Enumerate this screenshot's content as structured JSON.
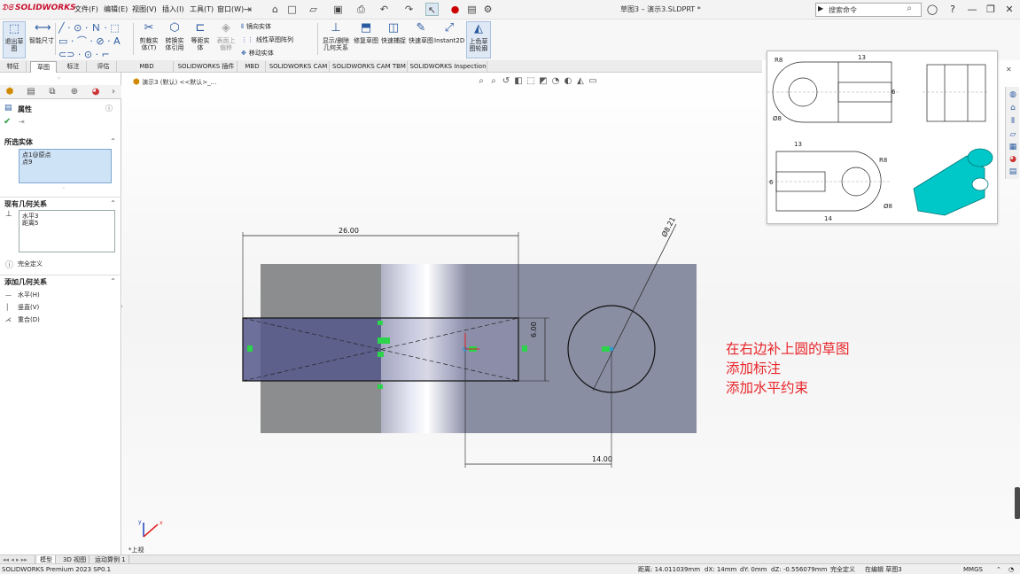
{
  "app": {
    "brand": "SOLIDWORKS"
  },
  "menu": [
    "文件(F)",
    "编辑(E)",
    "视图(V)",
    "插入(I)",
    "工具(T)",
    "窗口(W)"
  ],
  "title": "草图3 – 演示3.SLDPRT *",
  "search": {
    "placeholder": "搜索命令"
  },
  "ribbon": {
    "exit_sketch": "退出草图",
    "smart_dimension": "智能尺寸",
    "trim": "剪裁实体(T)",
    "convert": "转换实体引用",
    "offset": "等距实体",
    "surface_offset": "表面上偏移",
    "mirror": "镜向实体",
    "linear_pattern": "线性草图阵列",
    "move": "移动实体",
    "display_relations": "显示/删除几何关系",
    "repair": "修复草图",
    "quick_snaps": "快速捕捉",
    "rapid_sketch": "快速草图",
    "instant2d": "Instant2D",
    "shaded_contours": "上色草图轮廓"
  },
  "tabs": [
    "特征",
    "草图",
    "标注",
    "评估",
    "MBD Dimensions",
    "SOLIDWORKS 插件",
    "MBD",
    "SOLIDWORKS CAM",
    "SOLIDWORKS CAM TBM",
    "SOLIDWORKS Inspection"
  ],
  "breadcrumb": "演示3 (默认) <<默认>_...",
  "panel": {
    "title": "属性",
    "selected_entities_title": "所选实体",
    "selected_entities": [
      "点1@原点",
      "点9"
    ],
    "existing_relations_title": "现有几何关系",
    "existing_relations": [
      "水平3",
      "距离5"
    ],
    "status": "完全定义",
    "add_relations_title": "添加几何关系",
    "add_relations": [
      "水平(H)",
      "竖直(V)",
      "重合(D)"
    ]
  },
  "dimensions": {
    "width": "26.00",
    "height": "6.00",
    "diameter": "Ø8.21",
    "offset": "14.00"
  },
  "drawing_view": {
    "r_top": "R8",
    "top_13": "13",
    "top_6": "6",
    "top_d": "Ø8",
    "bottom_13": "13",
    "bottom_r": "R8",
    "bottom_14": "14",
    "bottom_6": "6",
    "bottom_d": "Ø8"
  },
  "annotation": [
    "在右边补上圆的草图",
    "添加标注",
    "添加水平约束"
  ],
  "view_label": "*上视",
  "triad": {
    "x": "x",
    "y": "y"
  },
  "bottom_tabs": [
    "模型",
    "3D 视图",
    "运动算例 1"
  ],
  "status": {
    "product": "SOLIDWORKS Premium 2023 SP0.1",
    "distance": "距离: 14.011039mm",
    "dx": "dX: 14mm",
    "dy": "dY: 0mm",
    "dz": "dZ: -0.556079mm",
    "defined": "完全定义",
    "editing": "在编辑 草图3",
    "units": "MMGS"
  }
}
